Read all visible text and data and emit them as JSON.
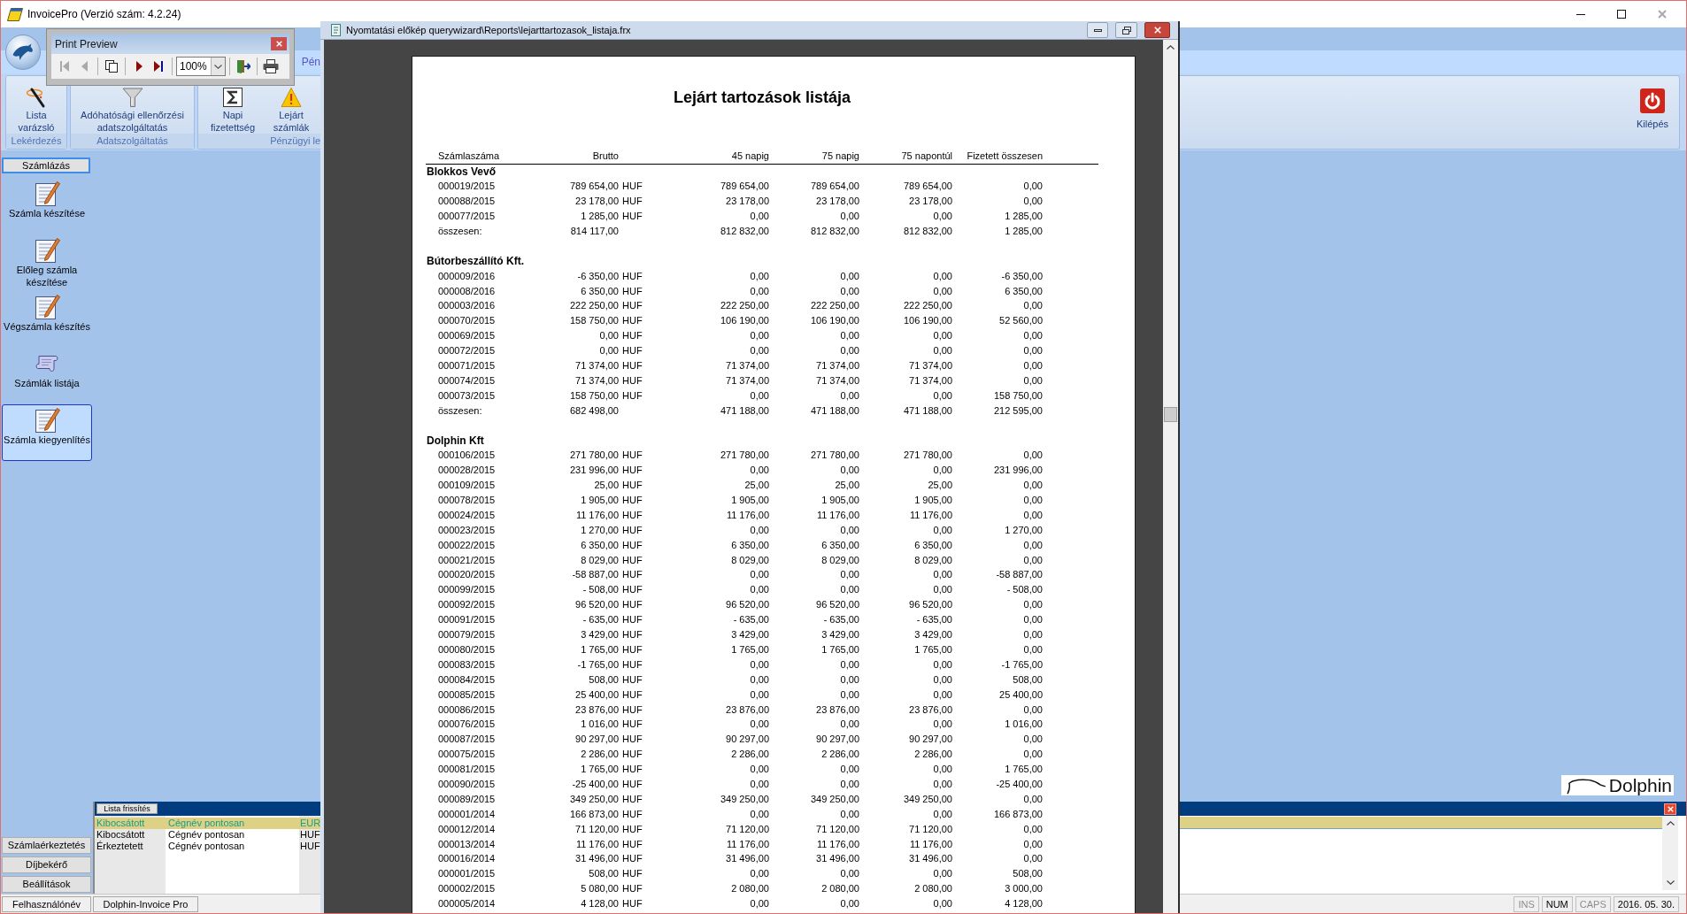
{
  "window": {
    "title": "InvoicePro (Verzió szám: 4.2.24)"
  },
  "ribbon": {
    "tabs": [
      {
        "label": "Pén"
      }
    ],
    "groups": [
      {
        "label": "Lekérdezés",
        "buttons": [
          {
            "kind": "wand",
            "label": "Lista varázsló"
          }
        ]
      },
      {
        "label": "Adatszolgáltatás",
        "buttons": [
          {
            "kind": "funnel",
            "label": "Adóhatósági ellenőrzési adatszolgáltatás"
          }
        ]
      },
      {
        "label": "Pénzügyi le",
        "buttons": [
          {
            "kind": "sigma",
            "label": "Napi fizetettség"
          },
          {
            "kind": "warning",
            "label": "Lejárt számlák"
          }
        ]
      }
    ],
    "exit_button": {
      "label": "Kilépés"
    }
  },
  "print_preview": {
    "title": "Print Preview",
    "groups": [
      {
        "kind": "buttons",
        "buttons": [
          {
            "kind": "first",
            "disabled": true
          },
          {
            "kind": "previous",
            "disabled": true
          }
        ]
      },
      {
        "kind": "buttons",
        "buttons": [
          {
            "kind": "pages",
            "disabled": false
          }
        ]
      },
      {
        "kind": "buttons",
        "buttons": [
          {
            "kind": "next",
            "disabled": false
          },
          {
            "kind": "last",
            "disabled": false
          }
        ]
      },
      {
        "kind": "zoom",
        "value": "100%"
      },
      {
        "kind": "buttons",
        "buttons": [
          {
            "kind": "exit",
            "disabled": false
          }
        ]
      },
      {
        "kind": "buttons",
        "buttons": [
          {
            "kind": "print",
            "disabled": false
          }
        ]
      }
    ]
  },
  "sidebar": {
    "section": "Számlázás",
    "items": [
      {
        "label": "Számla készítése",
        "kind": "document",
        "selected": false
      },
      {
        "label": "Előleg számla készítése",
        "kind": "document",
        "selected": false
      },
      {
        "label": "Végszámla készítés",
        "kind": "document",
        "selected": false
      },
      {
        "label": "Számlák listája",
        "kind": "scroll",
        "selected": false
      },
      {
        "label": "Számla kiegyenlítés",
        "kind": "document",
        "selected": true
      }
    ],
    "bottom_buttons": [
      "Számlaérkeztetés",
      "Díjbekérő",
      "Beállítások"
    ]
  },
  "bottom_panel": {
    "tab": "Lista frissítés",
    "rows": [
      {
        "cells": [
          "Kibocsátott",
          "Cégnév pontosan",
          "EUR"
        ],
        "selected": true
      },
      {
        "cells": [
          "Kibocsátott",
          "Cégnév pontosan",
          "HUF"
        ],
        "selected": false
      },
      {
        "cells": [
          "Érkeztetett",
          "Cégnév pontosan",
          "HUF"
        ],
        "selected": false
      }
    ]
  },
  "logo": {
    "text": "Dolphin"
  },
  "status_bar": {
    "cells": [
      "Felhasználónév",
      "Dolphin-Invoice Pro"
    ],
    "indicators": [
      {
        "label": "INS",
        "on": false
      },
      {
        "label": "NUM",
        "on": true
      },
      {
        "label": "CAPS",
        "on": false
      }
    ],
    "date": "2016. 05. 30."
  },
  "report_window": {
    "title": "Nyomtatási előkép querywizard\\Reports\\lejarttartozasok_listaja.frx",
    "report": {
      "title": "Lejárt tartozások listája",
      "columns": [
        "Számlaszáma",
        "Brutto",
        "45 napig",
        "75 napig",
        "75 napontúl",
        "Fizetett összesen"
      ],
      "groups": [
        {
          "name": "Blokkos Vevő",
          "rows": [
            {
              "cells": [
                "000019/2015",
                "789 654,00",
                "789 654,00",
                "789 654,00",
                "789 654,00",
                "0,00"
              ],
              "currency": "HUF"
            },
            {
              "cells": [
                "000088/2015",
                "23 178,00",
                "23 178,00",
                "23 178,00",
                "23 178,00",
                "0,00"
              ],
              "currency": "HUF"
            },
            {
              "cells": [
                "000077/2015",
                "1 285,00",
                "0,00",
                "0,00",
                "0,00",
                "1 285,00"
              ],
              "currency": "HUF"
            }
          ],
          "total": {
            "cells": [
              "összesen:",
              "814 117,00",
              "812 832,00",
              "812 832,00",
              "812 832,00",
              "1 285,00"
            ]
          }
        },
        {
          "name": "Bútorbeszállító Kft.",
          "rows": [
            {
              "cells": [
                "000009/2016",
                "-6 350,00",
                "0,00",
                "0,00",
                "0,00",
                "-6 350,00"
              ],
              "currency": "HUF"
            },
            {
              "cells": [
                "000008/2016",
                "6 350,00",
                "0,00",
                "0,00",
                "0,00",
                "6 350,00"
              ],
              "currency": "HUF"
            },
            {
              "cells": [
                "000003/2016",
                "222 250,00",
                "222 250,00",
                "222 250,00",
                "222 250,00",
                "0,00"
              ],
              "currency": "HUF"
            },
            {
              "cells": [
                "000070/2015",
                "158 750,00",
                "106 190,00",
                "106 190,00",
                "106 190,00",
                "52 560,00"
              ],
              "currency": "HUF"
            },
            {
              "cells": [
                "000069/2015",
                "0,00",
                "0,00",
                "0,00",
                "0,00",
                "0,00"
              ],
              "currency": "HUF"
            },
            {
              "cells": [
                "000072/2015",
                "0,00",
                "0,00",
                "0,00",
                "0,00",
                "0,00"
              ],
              "currency": "HUF"
            },
            {
              "cells": [
                "000071/2015",
                "71 374,00",
                "71 374,00",
                "71 374,00",
                "71 374,00",
                "0,00"
              ],
              "currency": "HUF"
            },
            {
              "cells": [
                "000074/2015",
                "71 374,00",
                "71 374,00",
                "71 374,00",
                "71 374,00",
                "0,00"
              ],
              "currency": "HUF"
            },
            {
              "cells": [
                "000073/2015",
                "158 750,00",
                "0,00",
                "0,00",
                "0,00",
                "158 750,00"
              ],
              "currency": "HUF"
            }
          ],
          "total": {
            "cells": [
              "összesen:",
              "682 498,00",
              "471 188,00",
              "471 188,00",
              "471 188,00",
              "212 595,00"
            ]
          }
        },
        {
          "name": "Dolphin Kft",
          "rows": [
            {
              "cells": [
                "000106/2015",
                "271 780,00",
                "271 780,00",
                "271 780,00",
                "271 780,00",
                "0,00"
              ],
              "currency": "HUF"
            },
            {
              "cells": [
                "000028/2015",
                "231 996,00",
                "0,00",
                "0,00",
                "0,00",
                "231 996,00"
              ],
              "currency": "HUF"
            },
            {
              "cells": [
                "000109/2015",
                "25,00",
                "25,00",
                "25,00",
                "25,00",
                "0,00"
              ],
              "currency": "HUF"
            },
            {
              "cells": [
                "000078/2015",
                "1 905,00",
                "1 905,00",
                "1 905,00",
                "1 905,00",
                "0,00"
              ],
              "currency": "HUF"
            },
            {
              "cells": [
                "000024/2015",
                "11 176,00",
                "11 176,00",
                "11 176,00",
                "11 176,00",
                "0,00"
              ],
              "currency": "HUF"
            },
            {
              "cells": [
                "000023/2015",
                "1 270,00",
                "0,00",
                "0,00",
                "0,00",
                "1 270,00"
              ],
              "currency": "HUF"
            },
            {
              "cells": [
                "000022/2015",
                "6 350,00",
                "6 350,00",
                "6 350,00",
                "6 350,00",
                "0,00"
              ],
              "currency": "HUF"
            },
            {
              "cells": [
                "000021/2015",
                "8 029,00",
                "8 029,00",
                "8 029,00",
                "8 029,00",
                "0,00"
              ],
              "currency": "HUF"
            },
            {
              "cells": [
                "000020/2015",
                "-58 887,00",
                "0,00",
                "0,00",
                "0,00",
                "-58 887,00"
              ],
              "currency": "HUF"
            },
            {
              "cells": [
                "000099/2015",
                "- 508,00",
                "0,00",
                "0,00",
                "0,00",
                "- 508,00"
              ],
              "currency": "HUF"
            },
            {
              "cells": [
                "000092/2015",
                "96 520,00",
                "96 520,00",
                "96 520,00",
                "96 520,00",
                "0,00"
              ],
              "currency": "HUF"
            },
            {
              "cells": [
                "000091/2015",
                "- 635,00",
                "- 635,00",
                "- 635,00",
                "- 635,00",
                "0,00"
              ],
              "currency": "HUF"
            },
            {
              "cells": [
                "000079/2015",
                "3 429,00",
                "3 429,00",
                "3 429,00",
                "3 429,00",
                "0,00"
              ],
              "currency": "HUF"
            },
            {
              "cells": [
                "000080/2015",
                "1 765,00",
                "1 765,00",
                "1 765,00",
                "1 765,00",
                "0,00"
              ],
              "currency": "HUF"
            },
            {
              "cells": [
                "000083/2015",
                "-1 765,00",
                "0,00",
                "0,00",
                "0,00",
                "-1 765,00"
              ],
              "currency": "HUF"
            },
            {
              "cells": [
                "000084/2015",
                "508,00",
                "0,00",
                "0,00",
                "0,00",
                "508,00"
              ],
              "currency": "HUF"
            },
            {
              "cells": [
                "000085/2015",
                "25 400,00",
                "0,00",
                "0,00",
                "0,00",
                "25 400,00"
              ],
              "currency": "HUF"
            },
            {
              "cells": [
                "000086/2015",
                "23 876,00",
                "23 876,00",
                "23 876,00",
                "23 876,00",
                "0,00"
              ],
              "currency": "HUF"
            },
            {
              "cells": [
                "000076/2015",
                "1 016,00",
                "0,00",
                "0,00",
                "0,00",
                "1 016,00"
              ],
              "currency": "HUF"
            },
            {
              "cells": [
                "000087/2015",
                "90 297,00",
                "90 297,00",
                "90 297,00",
                "90 297,00",
                "0,00"
              ],
              "currency": "HUF"
            },
            {
              "cells": [
                "000075/2015",
                "2 286,00",
                "2 286,00",
                "2 286,00",
                "2 286,00",
                "0,00"
              ],
              "currency": "HUF"
            },
            {
              "cells": [
                "000081/2015",
                "1 765,00",
                "0,00",
                "0,00",
                "0,00",
                "1 765,00"
              ],
              "currency": "HUF"
            },
            {
              "cells": [
                "000090/2015",
                "-25 400,00",
                "0,00",
                "0,00",
                "0,00",
                "-25 400,00"
              ],
              "currency": "HUF"
            },
            {
              "cells": [
                "000089/2015",
                "349 250,00",
                "349 250,00",
                "349 250,00",
                "349 250,00",
                "0,00"
              ],
              "currency": "HUF"
            },
            {
              "cells": [
                "000001/2014",
                "166 873,00",
                "0,00",
                "0,00",
                "0,00",
                "166 873,00"
              ],
              "currency": "HUF"
            },
            {
              "cells": [
                "000012/2014",
                "71 120,00",
                "71 120,00",
                "71 120,00",
                "71 120,00",
                "0,00"
              ],
              "currency": "HUF"
            },
            {
              "cells": [
                "000013/2014",
                "11 176,00",
                "11 176,00",
                "11 176,00",
                "11 176,00",
                "0,00"
              ],
              "currency": "HUF"
            },
            {
              "cells": [
                "000016/2014",
                "31 496,00",
                "31 496,00",
                "31 496,00",
                "31 496,00",
                "0,00"
              ],
              "currency": "HUF"
            },
            {
              "cells": [
                "000001/2015",
                "508,00",
                "0,00",
                "0,00",
                "0,00",
                "508,00"
              ],
              "currency": "HUF"
            },
            {
              "cells": [
                "000002/2015",
                "5 080,00",
                "2 080,00",
                "2 080,00",
                "2 080,00",
                "3 000,00"
              ],
              "currency": "HUF"
            },
            {
              "cells": [
                "000005/2014",
                "4 128,00",
                "0,00",
                "0,00",
                "0,00",
                "4 128,00"
              ],
              "currency": "HUF"
            }
          ]
        }
      ]
    }
  }
}
